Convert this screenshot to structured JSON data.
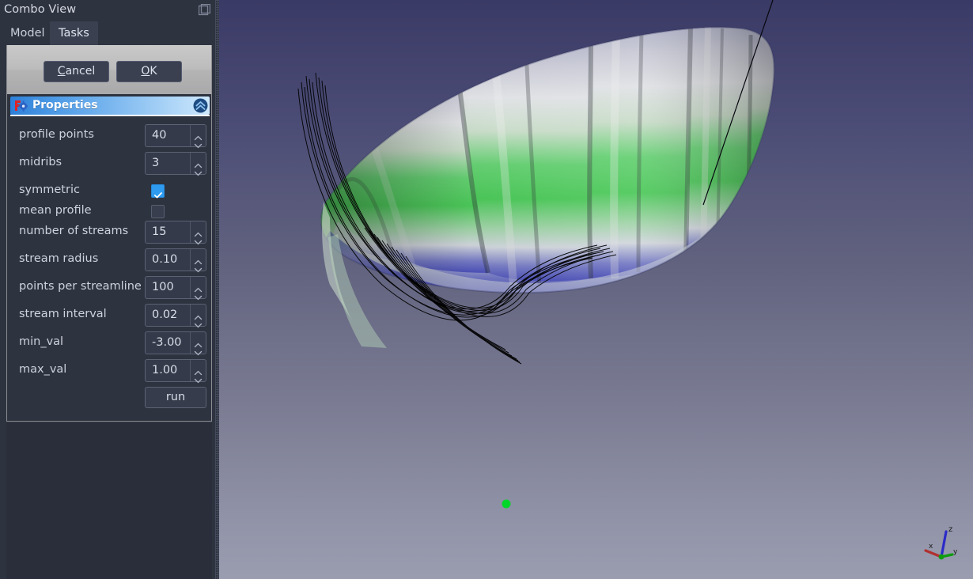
{
  "window": {
    "title": "Combo View",
    "float_icon": "float-window-icon"
  },
  "tabs": [
    {
      "label": "Model",
      "active": false
    },
    {
      "label": "Tasks",
      "active": true
    }
  ],
  "task_buttons": {
    "cancel": {
      "label": "Cancel",
      "accel": "C"
    },
    "ok": {
      "label": "OK",
      "accel": "O"
    }
  },
  "properties": {
    "header": "Properties",
    "header_icon": "freecad-logo-icon",
    "collapse_icon": "chevron-double-up-icon",
    "rows": [
      {
        "label": "profile points",
        "type": "spin",
        "value": "40"
      },
      {
        "label": "midribs",
        "type": "spin",
        "value": "3"
      },
      {
        "label": "symmetric",
        "type": "checkbox",
        "checked": true
      },
      {
        "label": "mean profile",
        "type": "checkbox",
        "checked": false
      },
      {
        "label": "number of streams",
        "type": "spin",
        "value": "15"
      },
      {
        "label": "stream radius",
        "type": "spin",
        "value": "0.10"
      },
      {
        "label": "points per streamline",
        "type": "spin",
        "value": "100"
      },
      {
        "label": "stream interval",
        "type": "spin",
        "value": "0.02"
      },
      {
        "label": "min_val",
        "type": "spin",
        "value": "-3.00"
      },
      {
        "label": "max_val",
        "type": "spin",
        "value": "1.00"
      },
      {
        "label": "",
        "type": "button",
        "value": "run"
      }
    ]
  },
  "viewport": {
    "scene": "paraglider-wing-cfd-streamlines",
    "background_top": "#3a3a66",
    "background_bottom": "#9a9cb0",
    "surface_colors": [
      "#3ddc4e",
      "#ffffff",
      "#4a4fd0"
    ],
    "streamline_color": "#000000",
    "marker_color": "#00d52a",
    "axis": {
      "x_label": "x",
      "x_color": "#c02020",
      "y_label": "y",
      "y_color": "#12b012",
      "z_label": "z",
      "z_color": "#2020c0"
    }
  }
}
